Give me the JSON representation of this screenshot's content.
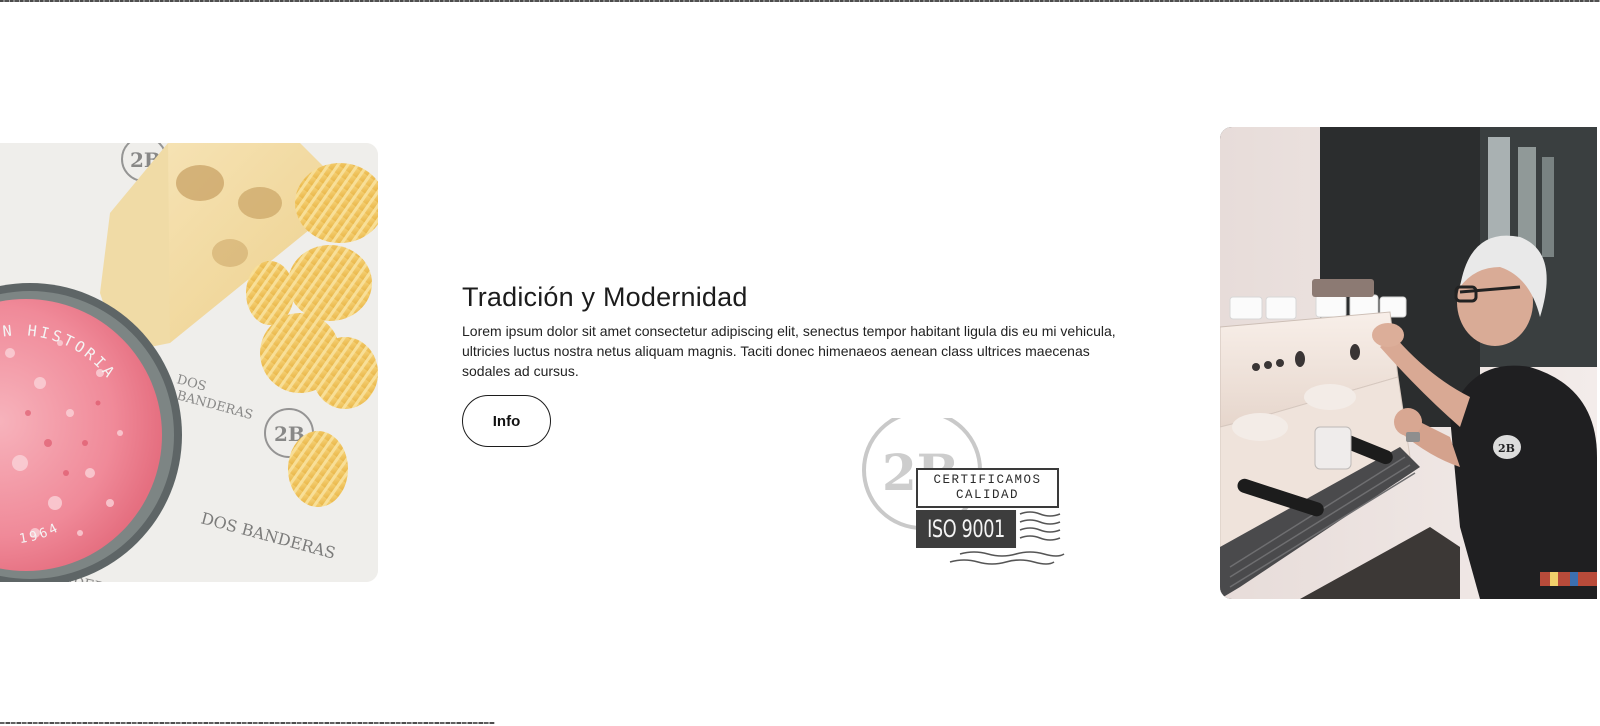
{
  "section": {
    "title": "Tradición y Modernidad",
    "body": "Lorem ipsum dolor sit amet consectetur adipiscing elit, senectus tempor habitant ligula dis eu mi vehicula, ultricies luctus nostra netus aliquam magnis. Taciti donec himenaeos aenean class ultrices maecenas sodales ad cursus.",
    "info_button_label": "Info"
  },
  "left_photo": {
    "subject": "pink-drink-with-toast-and-chips",
    "glass_text": "CON HISTORIA",
    "glass_year": "1964",
    "paper_logo": "2B",
    "paper_brand": "DOS BANDERAS"
  },
  "right_photo": {
    "subject": "barista-at-espresso-machine",
    "shirt_logo": "2B"
  },
  "stamp": {
    "logo": "2B",
    "line1": "CERTIFICAMOS",
    "line2": "CALIDAD",
    "iso": "ISO 9001"
  },
  "colors": {
    "text": "#1c1c1c",
    "button_border": "#1c1c1c",
    "background": "#ffffff",
    "drink_pink": "#f29aa6"
  }
}
